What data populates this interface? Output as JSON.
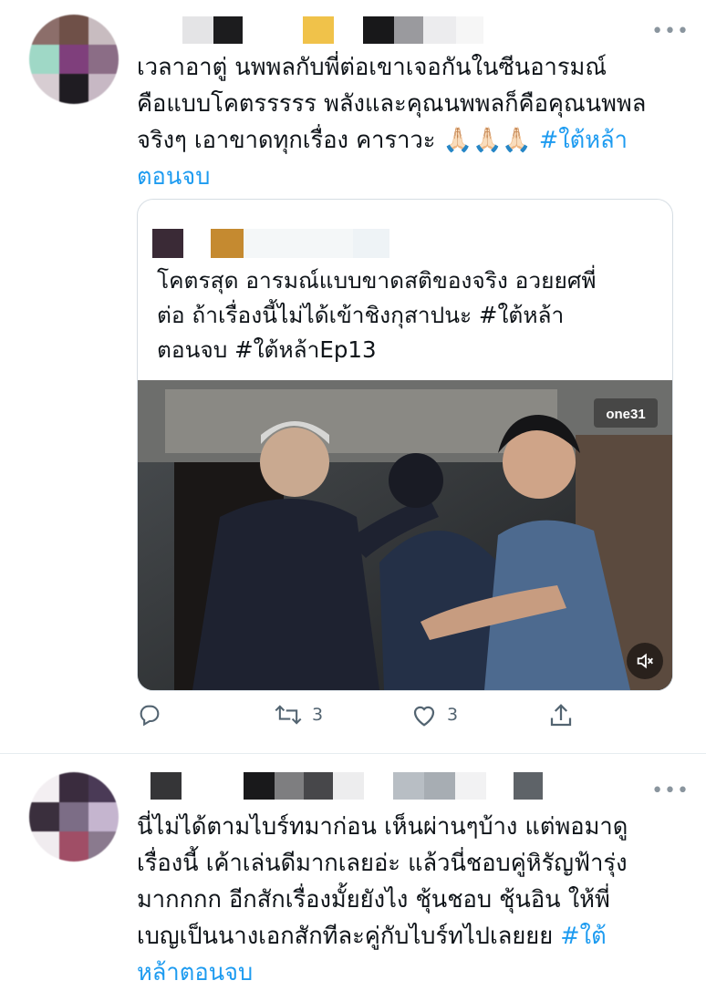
{
  "colors": {
    "hashtag": "#1d9bf0",
    "text": "#0f1419",
    "icon": "#536471"
  },
  "tweet1": {
    "more_label": "•••",
    "text_parts": [
      {
        "t": "เวลาอาตู่ นพพลกับพี่ต่อเขาเจอกันในซีนอารมณ์\nคือแบบโคตรรรรร พลังและคุณนพพลก็คือคุณนพพล\nจริงๆ เอาขาดทุกเรื่อง คาราวะ ",
        "kind": "text"
      },
      {
        "t": "🙏🏻🙏🏻🙏🏻",
        "kind": "emoji"
      },
      {
        "t": " ",
        "kind": "text"
      },
      {
        "t": "#ใต้หล้า\nตอนจบ",
        "kind": "hashtag"
      }
    ],
    "quote": {
      "text_parts": [
        {
          "t": "โคตรสุด อารมณ์แบบขาดสติของจริง อวยยศพี่\nต่อ ถ้าเรื่องนี้ไม่ได้เข้าชิงกุสาปนะ #ใต้หล้า\nตอนจบ #ใต้หล้าEp13",
          "kind": "text"
        }
      ],
      "media": {
        "watermark": "one31",
        "mute_icon": "volume-mute-icon"
      }
    },
    "actions": {
      "reply_count": "",
      "retweet_count": "3",
      "like_count": "3"
    }
  },
  "tweet2": {
    "more_label": "•••",
    "text_parts": [
      {
        "t": "นี่ไม่ได้ตามไบร์ทมาก่อน เห็นผ่านๆบ้าง แต่พอมาดู\nเรื่องนี้ เค้าเล่นดีมากเลยอ่ะ แล้วนี่ชอบคู่หิรัญฟ้ารุ่ง\nมากกกก อีกสักเรื่องมั้ยยังไง ชุ้นชอบ ชุ้นอิน ให้พี่\nเบญเป็นนางเอกสักทีละคู่กับไบร์ทไปเลยยย ",
        "kind": "text"
      },
      {
        "t": "#ใต้\nหล้าตอนจบ",
        "kind": "hashtag"
      }
    ]
  }
}
